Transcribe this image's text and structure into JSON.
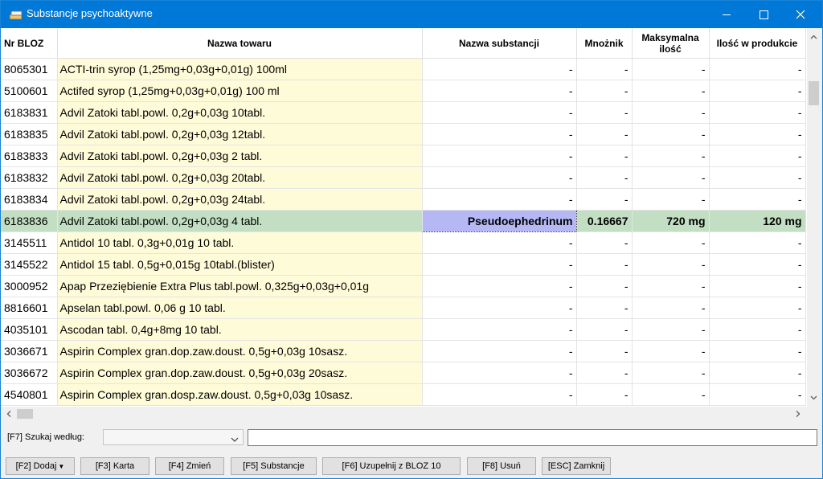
{
  "window": {
    "title": "Substancje psychoaktywne"
  },
  "table": {
    "columns": [
      "Nr BLOZ",
      "Nazwa towaru",
      "Nazwa substancji",
      "Mnożnik",
      "Maksymalna ilość",
      "Ilość w produkcie"
    ],
    "rows": [
      {
        "bloz": "8065301",
        "name": "ACTI-trin syrop (1,25mg+0,03g+0,01g) 100ml",
        "subst": "-",
        "mult": "-",
        "max": "-",
        "qty": "-"
      },
      {
        "bloz": "5100601",
        "name": "Actifed syrop (1,25mg+0,03g+0,01g) 100 ml",
        "subst": "-",
        "mult": "-",
        "max": "-",
        "qty": "-"
      },
      {
        "bloz": "6183831",
        "name": "Advil Zatoki tabl.powl. 0,2g+0,03g 10tabl.",
        "subst": "-",
        "mult": "-",
        "max": "-",
        "qty": "-"
      },
      {
        "bloz": "6183835",
        "name": "Advil Zatoki tabl.powl. 0,2g+0,03g 12tabl.",
        "subst": "-",
        "mult": "-",
        "max": "-",
        "qty": "-"
      },
      {
        "bloz": "6183833",
        "name": "Advil Zatoki tabl.powl. 0,2g+0,03g 2 tabl.",
        "subst": "-",
        "mult": "-",
        "max": "-",
        "qty": "-"
      },
      {
        "bloz": "6183832",
        "name": "Advil Zatoki tabl.powl. 0,2g+0,03g 20tabl.",
        "subst": "-",
        "mult": "-",
        "max": "-",
        "qty": "-"
      },
      {
        "bloz": "6183834",
        "name": "Advil Zatoki tabl.powl. 0,2g+0,03g 24tabl.",
        "subst": "-",
        "mult": "-",
        "max": "-",
        "qty": "-"
      },
      {
        "bloz": "6183836",
        "name": "Advil Zatoki tabl.powl. 0,2g+0,03g 4 tabl.",
        "subst": "Pseudoephedrinum",
        "mult": "0.16667",
        "max": "720 mg",
        "qty": "120 mg",
        "selected": true
      },
      {
        "bloz": "3145511",
        "name": "Antidol 10 tabl. 0,3g+0,01g 10 tabl.",
        "subst": "-",
        "mult": "-",
        "max": "-",
        "qty": "-"
      },
      {
        "bloz": "3145522",
        "name": "Antidol 15 tabl. 0,5g+0,015g 10tabl.(blister)",
        "subst": "-",
        "mult": "-",
        "max": "-",
        "qty": "-"
      },
      {
        "bloz": "3000952",
        "name": "Apap Przeziębienie Extra Plus tabl.powl. 0,325g+0,03g+0,01g",
        "subst": "-",
        "mult": "-",
        "max": "-",
        "qty": "-"
      },
      {
        "bloz": "8816601",
        "name": "Apselan tabl.powl. 0,06 g 10 tabl.",
        "subst": "-",
        "mult": "-",
        "max": "-",
        "qty": "-"
      },
      {
        "bloz": "4035101",
        "name": "Ascodan tabl. 0,4g+8mg 10 tabl.",
        "subst": "-",
        "mult": "-",
        "max": "-",
        "qty": "-"
      },
      {
        "bloz": "3036671",
        "name": "Aspirin Complex gran.dop.zaw.doust. 0,5g+0,03g 10sasz.",
        "subst": "-",
        "mult": "-",
        "max": "-",
        "qty": "-"
      },
      {
        "bloz": "3036672",
        "name": "Aspirin Complex gran.dop.zaw.doust. 0,5g+0,03g 20sasz.",
        "subst": "-",
        "mult": "-",
        "max": "-",
        "qty": "-"
      },
      {
        "bloz": "4540801",
        "name": "Aspirin Complex gran.dosp.zaw.doust. 0,5g+0,03g 10sasz.",
        "subst": "-",
        "mult": "-",
        "max": "-",
        "qty": "-"
      }
    ]
  },
  "search": {
    "label": "[F7] Szukaj według:",
    "selected": "",
    "value": ""
  },
  "buttons": {
    "add": "[F2] Dodaj",
    "card": "[F3] Karta",
    "edit": "[F4] Zmień",
    "substances": "[F5] Substancje",
    "fill": "[F6] Uzupełnij z BLOZ 10",
    "delete": "[F8] Usuń",
    "close": "[ESC] Zamknij"
  },
  "colors": {
    "titlebar": "#0078d7",
    "name_column": "#fefbd8",
    "selected_row": "#c3dfc3",
    "active_cell": "#b5b8f5"
  }
}
